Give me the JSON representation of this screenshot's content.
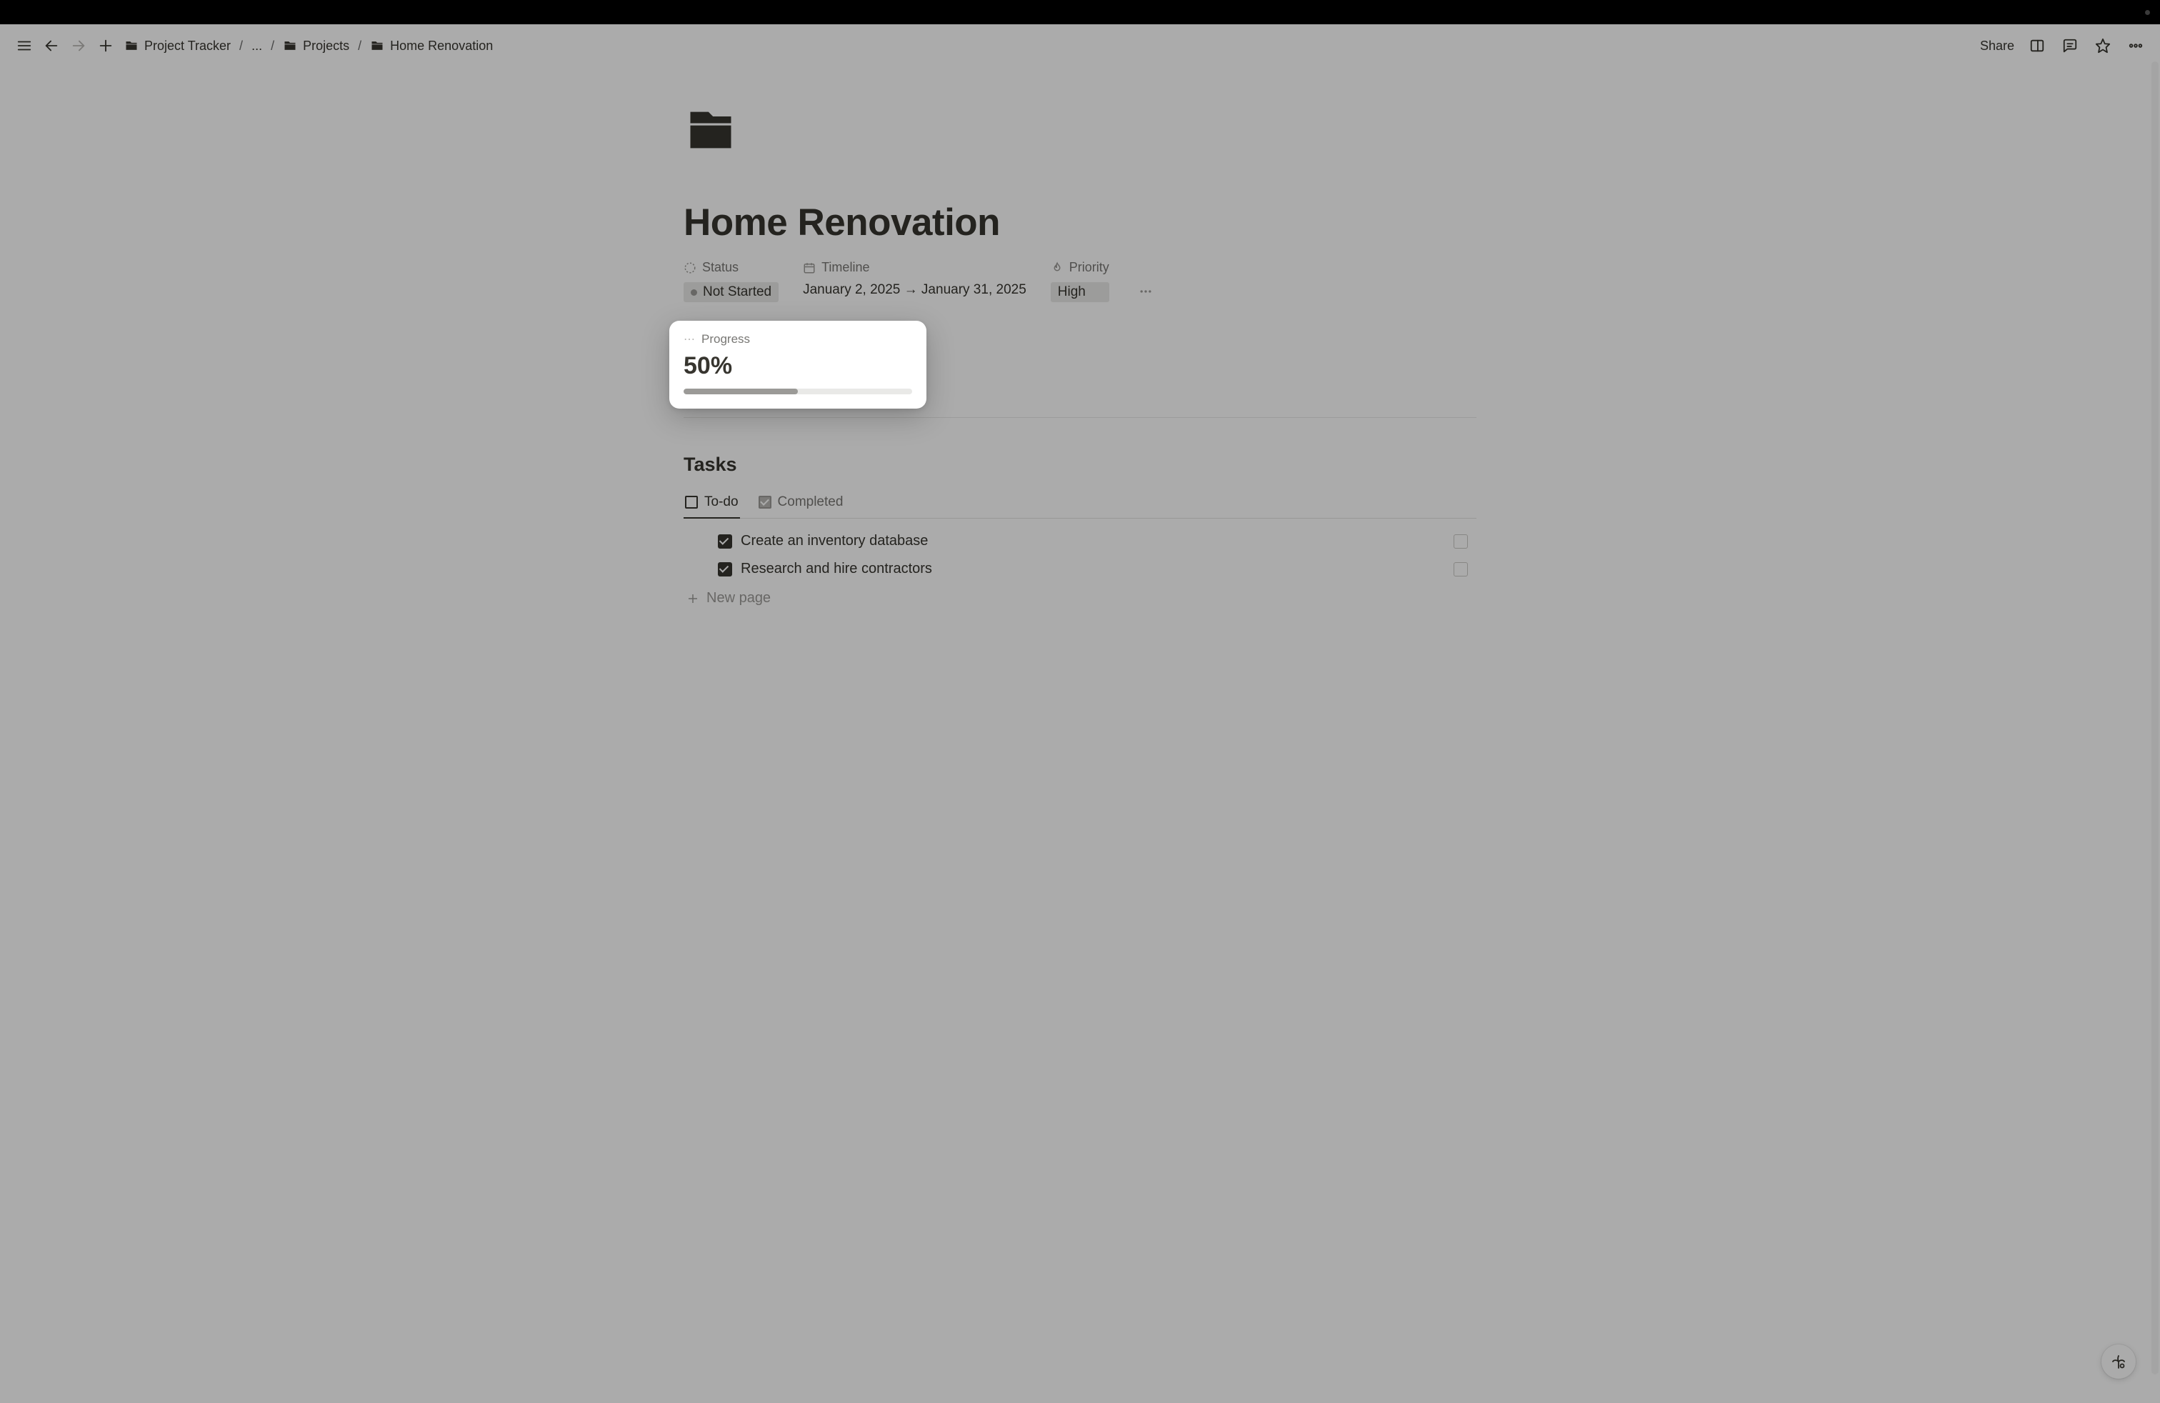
{
  "breadcrumb": {
    "root": "Project Tracker",
    "ellipsis": "...",
    "folder": "Projects",
    "page": "Home Renovation"
  },
  "topbar": {
    "share": "Share"
  },
  "page": {
    "title": "Home Renovation"
  },
  "props": {
    "status": {
      "label": "Status",
      "value": "Not Started"
    },
    "timeline": {
      "label": "Timeline",
      "value": "January 2, 2025 → January 31, 2025"
    },
    "priority": {
      "label": "Priority",
      "value": "High"
    }
  },
  "progress": {
    "label": "Progress",
    "value_text": "50%",
    "percent": 50
  },
  "tasks": {
    "heading": "Tasks",
    "tabs": {
      "todo": "To-do",
      "completed": "Completed"
    },
    "items": [
      {
        "title": "Create an inventory database",
        "checked": true
      },
      {
        "title": "Research and hire contractors",
        "checked": true
      }
    ],
    "new_page": "New page"
  }
}
